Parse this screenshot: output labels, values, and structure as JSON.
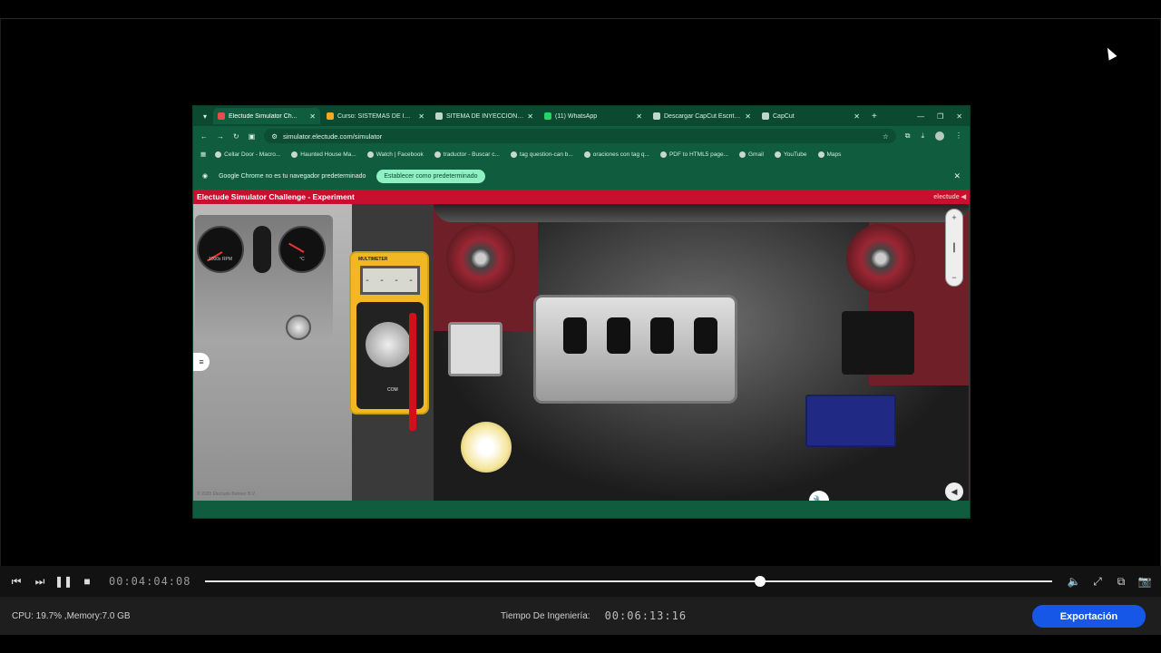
{
  "browser": {
    "tabs": [
      {
        "label": "Electude Simulator Ch...",
        "color": "#e84b4b",
        "active": true
      },
      {
        "label": "Curso: SISTEMAS DE INYE...",
        "color": "#f5a623"
      },
      {
        "label": "SITEMA DE INYECCION _A...",
        "color": "#c0d8cc"
      },
      {
        "label": "(11) WhatsApp",
        "color": "#25d366"
      },
      {
        "label": "Descargar CapCut Escritori...",
        "color": "#c0d8cc"
      },
      {
        "label": "CapCut",
        "color": "#c0d8cc"
      }
    ],
    "url": "simulator.electude.com/simulator",
    "bookmarks": [
      "Cellar Door - Macro...",
      "Haunted House Ma...",
      "Watch | Facebook",
      "traductor - Buscar c...",
      "tag question-can b...",
      "oraciones con tag q...",
      "PDF to HTML5 page...",
      "Gmail",
      "YouTube",
      "Maps"
    ],
    "infobar_text": "Google Chrome no es tu navegador predeterminado",
    "infobar_button": "Establecer como predeterminado"
  },
  "simulator": {
    "title": "Electude Simulator Challenge - Experiment",
    "logo": "electude",
    "multimeter_label": "MULTIMETER",
    "multimeter_display": "- - - -",
    "multimeter_port": "COM",
    "rpm_label": "1000x RPM",
    "temp_label": "°C",
    "copyright": "© 2020 Electude Beheer B.V."
  },
  "player": {
    "current_time": "00:04:04:08",
    "progress": 0.655
  },
  "statusbar": {
    "cpu_memory": "CPU: 19.7% ,Memory:7.0 GB",
    "engineering_label": "Tiempo De Ingeniería:",
    "engineering_time": "00:06:13:16",
    "export_label": "Exportación"
  },
  "colors": {
    "export_button": "#1757e8",
    "browser_frame": "#0f5d3e",
    "sim_title_bar": "#c8102e"
  }
}
